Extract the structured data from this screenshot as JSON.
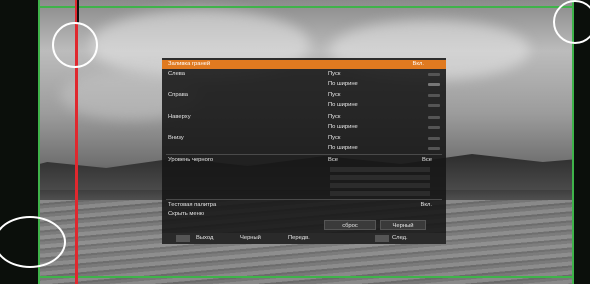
{
  "menu": {
    "header": {
      "label": "Заливка граней",
      "value": "Вкл."
    },
    "rows": [
      {
        "label": "Слева",
        "value": "Пуск"
      },
      {
        "label": "",
        "value": "По ширине"
      },
      {
        "label": "Справа",
        "value": "Пуск"
      },
      {
        "label": "",
        "value": "По ширине"
      },
      {
        "label": "Наверху",
        "value": "Пуск"
      },
      {
        "label": "",
        "value": "По ширине"
      },
      {
        "label": "Внизу",
        "value": "Пуск"
      },
      {
        "label": "",
        "value": "По ширине"
      }
    ],
    "black_level": {
      "label": "Уровень черного",
      "value": "Все",
      "right": "Все"
    },
    "test_palette": {
      "label": "Тестовая палитра",
      "value": "Вкл."
    },
    "hide_menu": {
      "label": "Скрыть меню"
    },
    "reset_label": "сброс",
    "black_label": "Черный"
  },
  "bottom_bar": {
    "exit": "Выход",
    "black": "Черный",
    "prev": "Передв.",
    "next": "След."
  },
  "colors": {
    "highlight": "#e07a20",
    "guide_green": "#3fb34a",
    "guide_red": "#e0282e"
  }
}
